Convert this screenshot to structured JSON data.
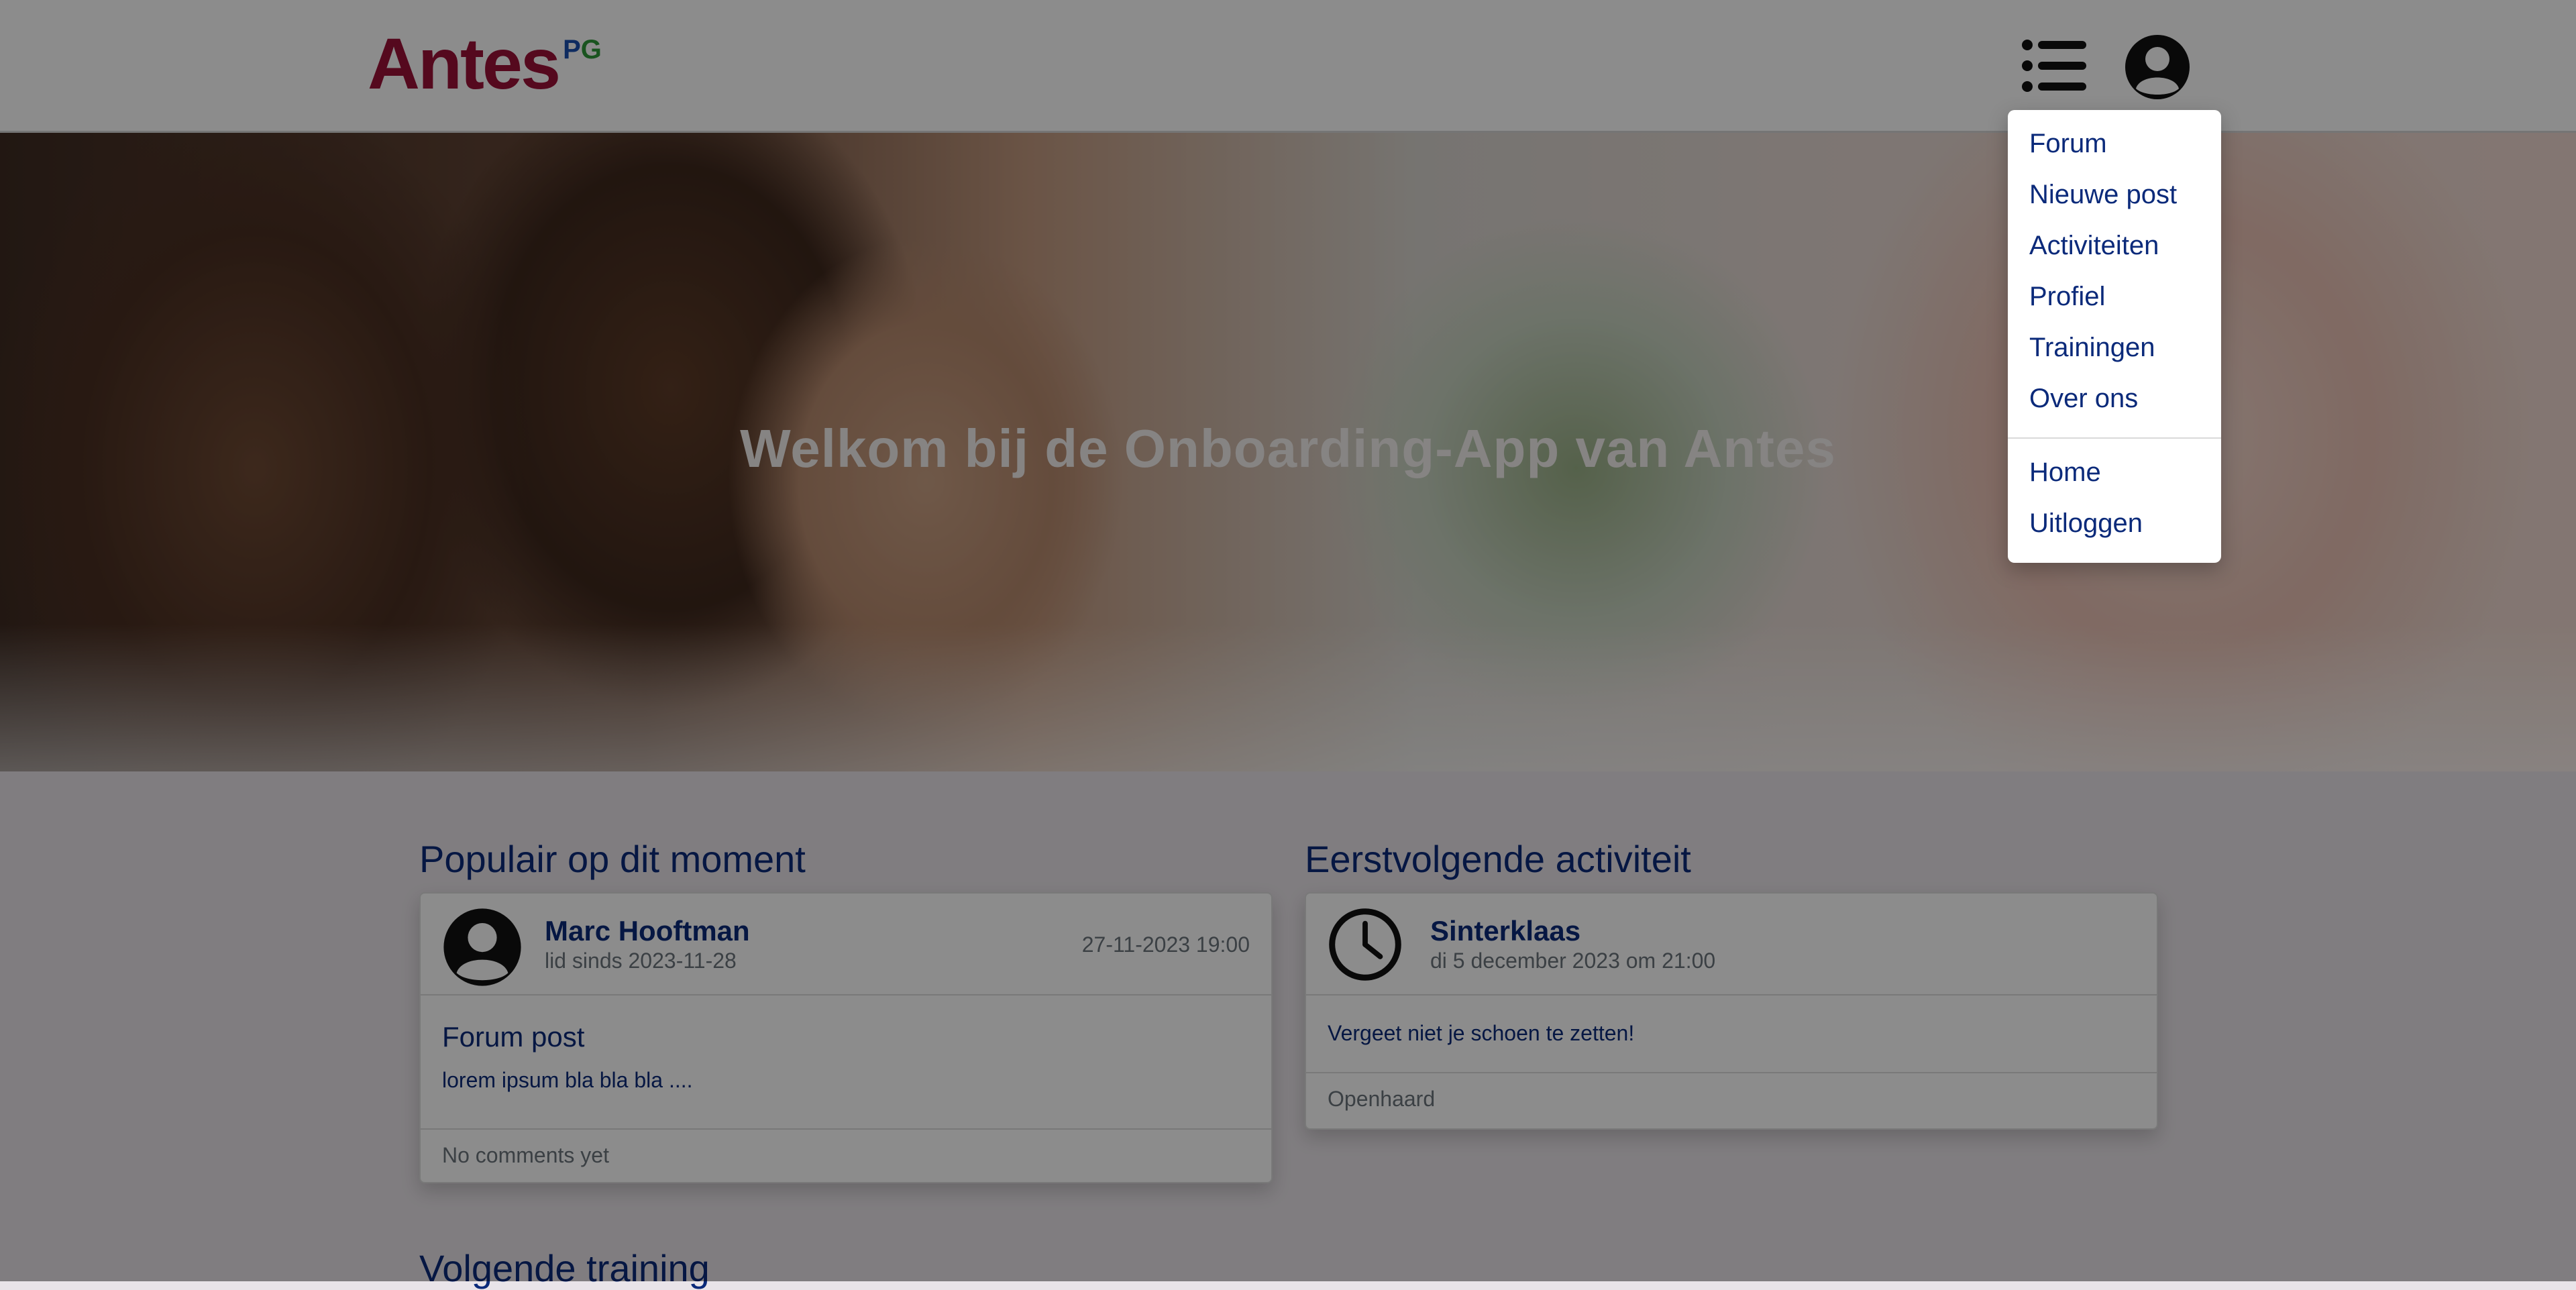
{
  "brand": {
    "name": "Antes",
    "superscript_p": "P",
    "superscript_g": "G"
  },
  "header": {
    "menu_icon": "menu-list-icon",
    "avatar_icon": "user-avatar-icon"
  },
  "hero": {
    "title": "Welkom bij de Onboarding-App van Antes"
  },
  "popular": {
    "title": "Populair op dit moment",
    "author": "Marc Hooftman",
    "member_since": "lid sinds 2023-11-28",
    "date": "27-11-2023 19:00",
    "post_title": "Forum post",
    "post_text": "lorem ipsum bla bla bla ....",
    "footer": "No comments yet"
  },
  "activity": {
    "title": "Eerstvolgende activiteit",
    "name": "Sinterklaas",
    "when": "di 5 december 2023 om 21:00",
    "text": "Vergeet niet je schoen te zetten!",
    "location": "Openhaard"
  },
  "next_training": {
    "title": "Volgende training"
  },
  "menu": {
    "items": [
      "Forum",
      "Nieuwe post",
      "Activiteiten",
      "Profiel",
      "Trainingen",
      "Over ons"
    ],
    "secondary": [
      "Home",
      "Uitloggen"
    ]
  },
  "colors": {
    "brand_red": "#9b1238",
    "primary_blue": "#0b2a7a"
  }
}
